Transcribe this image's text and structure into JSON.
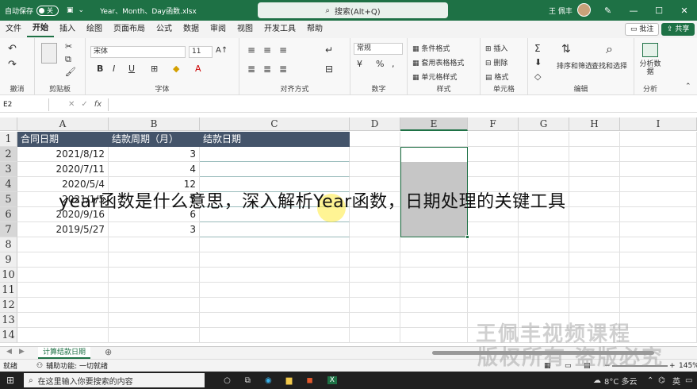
{
  "titlebar": {
    "autosave_label": "自动保存",
    "autosave_state": "关",
    "filename": "Year、Month、Day函数.xlsx",
    "search_placeholder": "搜索(Alt+Q)",
    "user_name": "王 佩丰"
  },
  "menu": [
    "文件",
    "开始",
    "插入",
    "绘图",
    "页面布局",
    "公式",
    "数据",
    "审阅",
    "视图",
    "开发工具",
    "帮助"
  ],
  "menu_active": "开始",
  "menu_right": {
    "comment": "批注",
    "share": "共享"
  },
  "ribbon": {
    "groups": [
      "撤消",
      "剪贴板",
      "字体",
      "对齐方式",
      "数字",
      "样式",
      "单元格",
      "编辑"
    ],
    "font_name": "宋体",
    "font_size": "11",
    "number_format": "常规",
    "style_items": [
      "条件格式",
      "套用表格格式",
      "单元格样式"
    ],
    "cell_items": [
      "插入",
      "删除",
      "格式"
    ],
    "edit_items": [
      "排序和筛选",
      "查找和选择"
    ],
    "analyze_label": "分析数据",
    "analyze_group": "分析"
  },
  "formula_bar": {
    "name_box": "E2",
    "fx": "fx"
  },
  "columns": [
    "A",
    "B",
    "C",
    "D",
    "E",
    "F",
    "G",
    "H",
    "I"
  ],
  "rows": [
    "1",
    "2",
    "3",
    "4",
    "5",
    "6",
    "7",
    "8",
    "9",
    "10",
    "11",
    "12",
    "13",
    "14"
  ],
  "table": {
    "headers": [
      "合同日期",
      "结款周期（月）",
      "结款日期"
    ],
    "rows": [
      [
        "2021/8/12",
        "3"
      ],
      [
        "2020/7/11",
        "4"
      ],
      [
        "2020/5/4",
        "12"
      ],
      [
        "2021/1/5",
        "5"
      ],
      [
        "2020/9/16",
        "6"
      ],
      [
        "2019/5/27",
        "3"
      ]
    ]
  },
  "sheet_tab": "计算结款日期",
  "status": {
    "ready": "就绪",
    "accessibility": "辅助功能: 一切就绪",
    "zoom": "145%"
  },
  "taskbar": {
    "search_placeholder": "在这里输入你要搜索的内容",
    "weather": "8°C 多云",
    "lang": "英"
  },
  "overlay_title": "year函数是什么意思，深入解析Year函数，日期处理的关键工具",
  "watermark": {
    "line1": "王佩丰视频课程",
    "line2": "版权所有 盗版必究"
  },
  "colors": {
    "accent": "#1e7145",
    "header_fill": "#44546a"
  }
}
